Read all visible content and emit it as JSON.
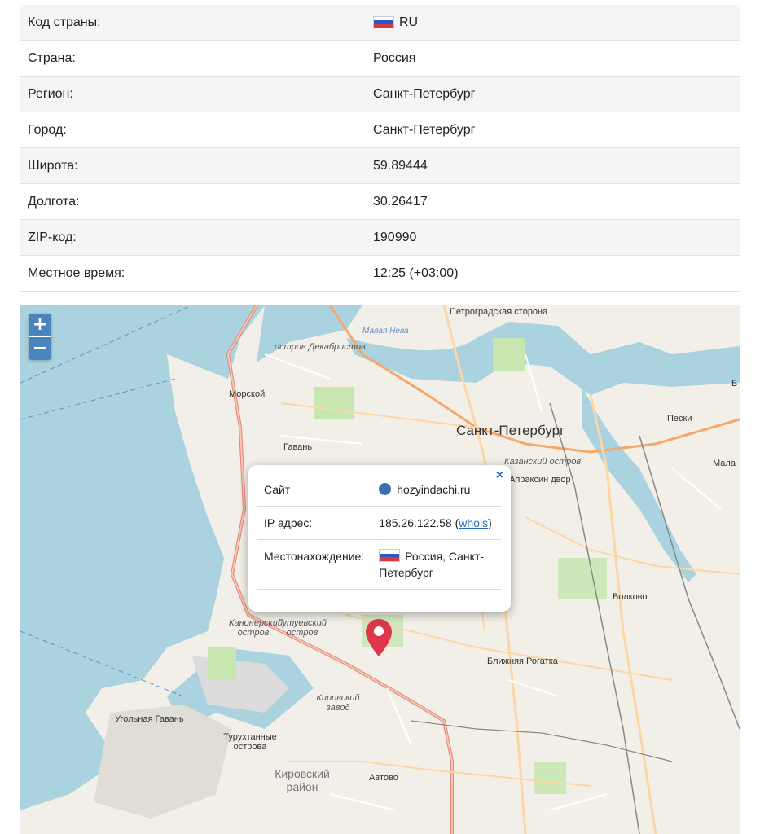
{
  "info": {
    "rows": [
      {
        "label": "Код страны:",
        "value": "RU",
        "flag": true
      },
      {
        "label": "Страна:",
        "value": "Россия"
      },
      {
        "label": "Регион:",
        "value": "Санкт-Петербург"
      },
      {
        "label": "Город:",
        "value": "Санкт-Петербург"
      },
      {
        "label": "Широта:",
        "value": "59.89444"
      },
      {
        "label": "Долгота:",
        "value": "30.26417"
      },
      {
        "label": "ZIP-код:",
        "value": "190990"
      },
      {
        "label": "Местное время:",
        "value": "12:25 (+03:00)"
      }
    ]
  },
  "map": {
    "zoom_in": "+",
    "zoom_out": "−",
    "labels": {
      "petrogradskaya": "Петроградская сторона",
      "malaya_neva": "Малая Нева",
      "dekabristov": "остров Декабристов",
      "morskoy": "Морской",
      "gavan": "Гавань",
      "spb": "Санкт-Петербург",
      "peski": "Пески",
      "kazansky": "Казанский остров",
      "apraksin": "Апраксин двор",
      "malaya_ohta": "Мала",
      "b_edge": "Б",
      "volkovo": "Волково",
      "kanonersky": "Канонерский остров",
      "gutuevsky": "Гутуевский остров",
      "blizhnyaya": "Ближняя Рогатка",
      "kirovsky_zavod": "Кировский завод",
      "ugolnaya": "Угольная Гавань",
      "turukhtannye": "Турухтанные острова",
      "kirovsky_rayon": "Кировский район",
      "avtovo": "Автово"
    }
  },
  "popup": {
    "close": "×",
    "site_label": "Сайт",
    "site_value": "hozyindachi.ru",
    "ip_label": "IP адрес:",
    "ip_value": "185.26.122.58",
    "whois": "whois",
    "location_label": "Местонахождение:",
    "location_value": "Россия, Санкт-Петербург"
  },
  "colors": {
    "accent": "#4a84bd",
    "pin": "#e0364a",
    "water": "#aad3df",
    "road_major": "#f7c7b0",
    "road_primary": "#fcd6a4"
  }
}
